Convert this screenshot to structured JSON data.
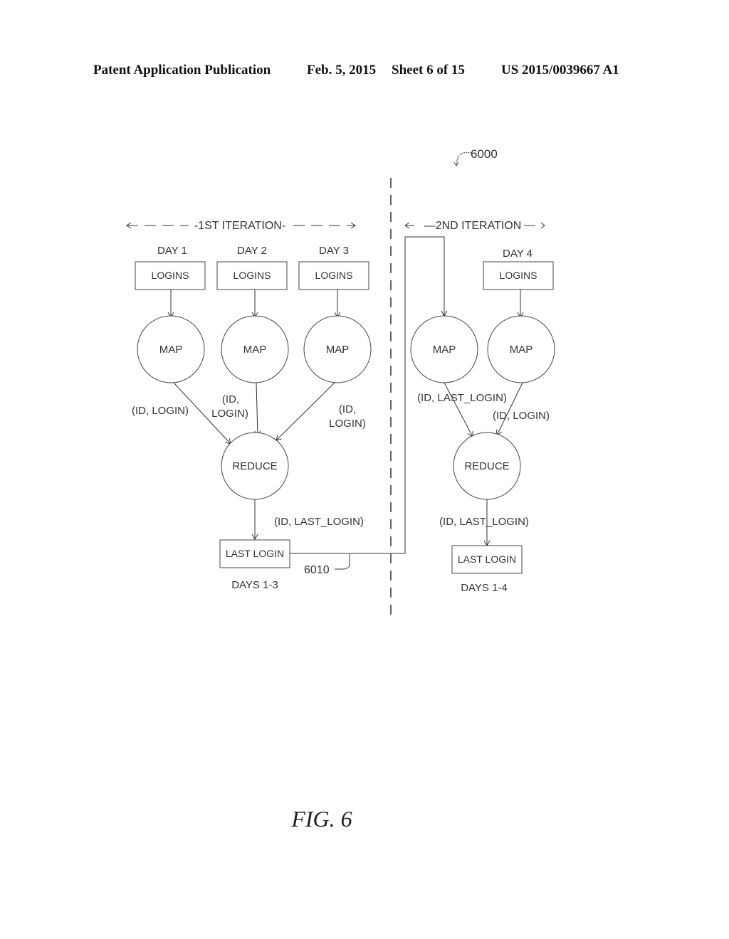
{
  "header": {
    "publication": "Patent Application Publication",
    "date": "Feb. 5, 2015",
    "sheet": "Sheet 6 of 15",
    "number": "US 2015/0039667 A1"
  },
  "figure": {
    "ref_main": "6000",
    "ref_link": "6010",
    "caption": "FIG. 6",
    "iteration1": "-1ST ITERATION-",
    "iteration2": "—2ND ITERATION",
    "days": [
      "DAY 1",
      "DAY 2",
      "DAY 3",
      "DAY 4"
    ],
    "logins_label": "LOGINS",
    "map_label": "MAP",
    "reduce_label": "REDUCE",
    "last_login_label": "LAST LOGIN",
    "edge_id_login": "(ID, LOGIN)",
    "edge_id_comma": "(ID,",
    "edge_login_paren": "LOGIN)",
    "edge_id_last_login": "(ID, LAST_LOGIN)",
    "days_1_3": "DAYS 1-3",
    "days_1_4": "DAYS 1-4"
  }
}
